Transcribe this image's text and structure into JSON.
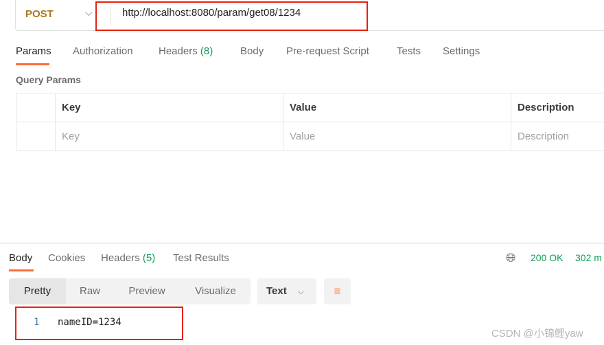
{
  "request": {
    "method": "POST",
    "url": "http://localhost:8080/param/get08/1234"
  },
  "tabs": [
    {
      "label": "Params"
    },
    {
      "label": "Authorization"
    },
    {
      "label": "Headers",
      "count": "(8)"
    },
    {
      "label": "Body"
    },
    {
      "label": "Pre-request Script"
    },
    {
      "label": "Tests"
    },
    {
      "label": "Settings"
    }
  ],
  "query_params": {
    "title": "Query Params",
    "headers": [
      "Key",
      "Value",
      "Description"
    ],
    "placeholders": [
      "Key",
      "Value",
      "Description"
    ]
  },
  "response": {
    "tabs": [
      {
        "label": "Body"
      },
      {
        "label": "Cookies"
      },
      {
        "label": "Headers",
        "count": "(5)"
      },
      {
        "label": "Test Results"
      }
    ],
    "status": "200 OK",
    "time": "302 m",
    "views": [
      "Pretty",
      "Raw",
      "Preview",
      "Visualize"
    ],
    "format": "Text",
    "lines": [
      {
        "num": "1",
        "text": "nameID=1234"
      }
    ]
  },
  "watermark": "CSDN @小锦鲤yaw",
  "colors": {
    "accent": "#ff6c37",
    "method": "#a8791a",
    "success": "#0f9d58",
    "highlight": "#e8210f"
  }
}
